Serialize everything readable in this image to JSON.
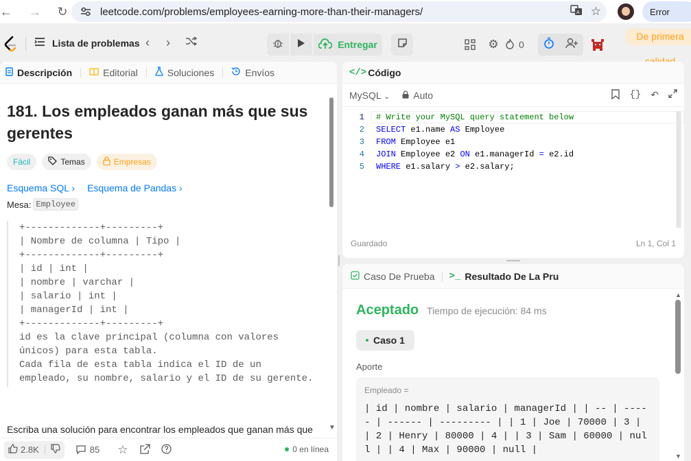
{
  "browser": {
    "url": "leetcode.com/problems/employees-earning-more-than-their-managers/",
    "profile_button": "Error"
  },
  "nav": {
    "problem_list": "Lista de problemas",
    "submit": "Entregar",
    "streak_count": "0",
    "premium_line1": "De primera",
    "premium_line2": "calidad"
  },
  "left_tabs": {
    "description": "Descripción",
    "editorial": "Editorial",
    "solutions": "Soluciones",
    "submissions": "Envíos"
  },
  "problem": {
    "title": "181. Los empleados ganan más que sus gerentes",
    "difficulty": "Fácil",
    "topics": "Temas",
    "companies": "Empresas",
    "sql_schema": "Esquema SQL",
    "pandas_schema": "Esquema de Pandas",
    "table_label": "Mesa:",
    "table_name": "Employee",
    "schema_block": "+-------------+---------+\n| Nombre de columna | Tipo |\n+-------------+---------+\n| id | int |\n| nombre | varchar |\n| salario | int |\n| managerId | int |\n+-------------+---------+\nid es la clave principal (columna con valores\núnicos) para esta tabla.\nCada fila de esta tabla indica el ID de un\nempleado, su nombre, salario y el ID de su gerente.",
    "statement": "Escriba una solución para encontrar los empleados que ganan más que"
  },
  "left_footer": {
    "likes": "2.8K",
    "comments": "85",
    "online": "0 en línea"
  },
  "code_panel": {
    "tab": "Código",
    "language": "MySQL",
    "mode": "Auto",
    "status_left": "Guardado",
    "status_right": "Ln 1, Col 1",
    "lines": [
      "# Write your MySQL query statement below",
      "SELECT e1.name AS Employee",
      "FROM Employee e1",
      "JOIN Employee e2 ON e1.managerId = e2.id",
      "WHERE e1.salary > e2.salary;"
    ]
  },
  "result_panel": {
    "tab_testcase": "Caso De Prueba",
    "tab_result": "Resultado De La Pru",
    "verdict": "Aceptado",
    "runtime": "Tiempo de ejecución: 84 ms",
    "case": "Caso 1",
    "input_heading": "Aporte",
    "input_label": "Empleado =",
    "input_value": "| id | nombre | salario | managerId | | -- | ----- | ------ | --------- | | 1 | Joe | 70000 | 3 | | 2 | Henry | 80000 | 4 | | 3 | Sam | 60000 | null | | 4 | Max | 90000 | null |"
  },
  "colors": {
    "accepted": "#2db55d",
    "premium": "#ffa116",
    "link": "#007aff"
  }
}
